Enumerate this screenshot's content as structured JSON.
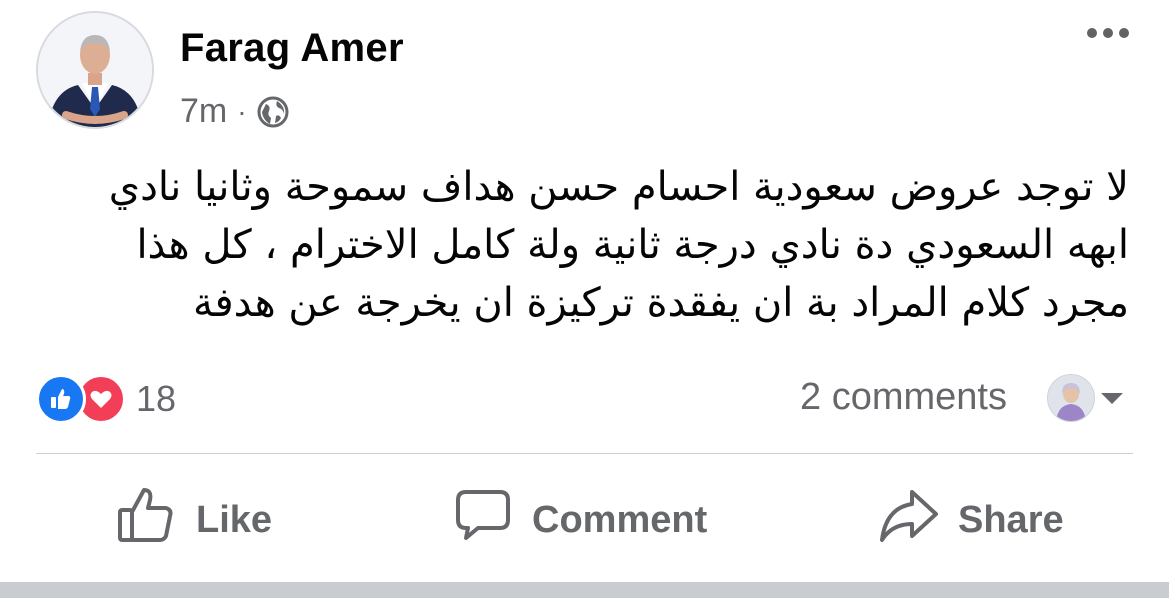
{
  "post": {
    "author": "Farag Amer",
    "time": "7m",
    "separator": "·",
    "privacy_icon": "globe-icon",
    "more_icon": "more-horizontal-icon",
    "text": "لا توجد عروض سعودية احسام حسن هداف سموحة  وثانيا نادي ابهه السعودي دة نادي درجة ثانية ولة  كامل  الاخترام  ، كل هذا مجرد كلام المراد بة ان يفقدة تركيزة ان يخرجة عن هدفة"
  },
  "reactions": {
    "icons": [
      "like-reaction-icon",
      "love-reaction-icon"
    ],
    "count": "18"
  },
  "comments": {
    "count_label": "2 comments"
  },
  "actions": {
    "like": "Like",
    "comment": "Comment",
    "share": "Share"
  },
  "colors": {
    "like_blue": "#1877f2",
    "love_red": "#f33e58",
    "secondary_text": "#65676b"
  }
}
